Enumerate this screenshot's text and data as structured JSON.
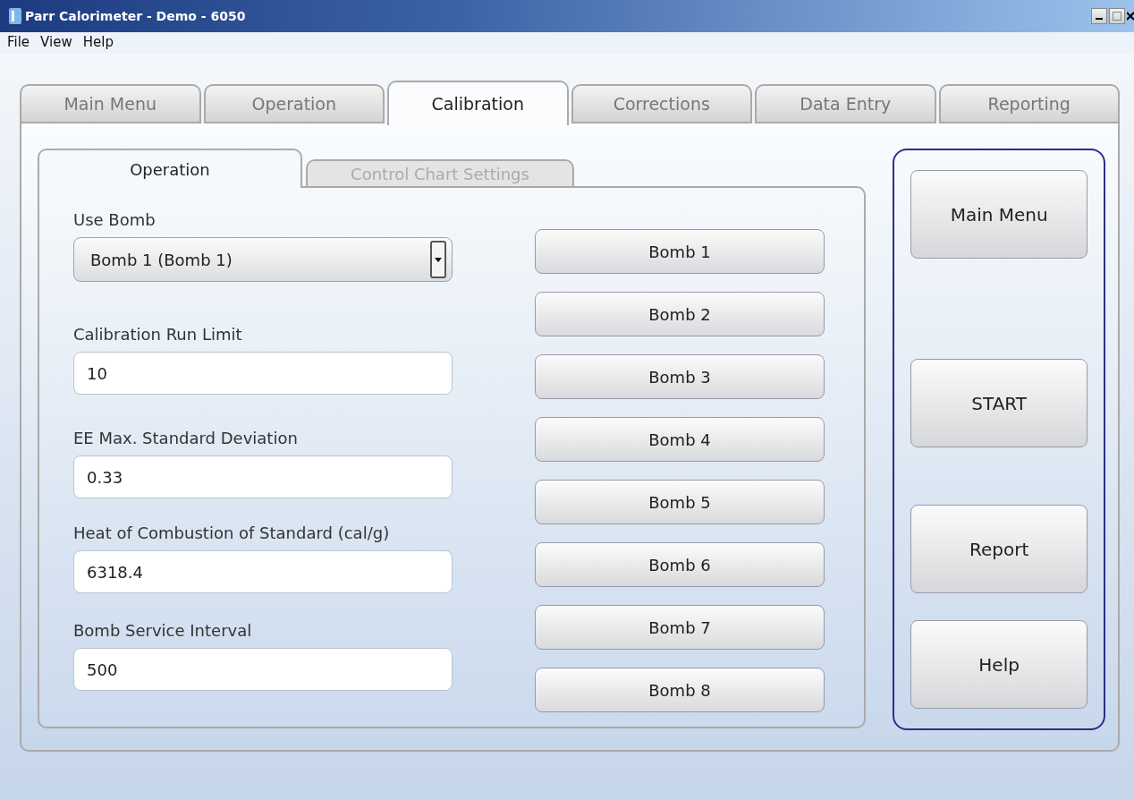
{
  "window": {
    "title": "Parr Calorimeter - Demo - 6050"
  },
  "menu": [
    "File",
    "View",
    "Help"
  ],
  "tabs": [
    {
      "label": "Main Menu",
      "selected": false
    },
    {
      "label": "Operation",
      "selected": false
    },
    {
      "label": "Calibration",
      "selected": true
    },
    {
      "label": "Corrections",
      "selected": false
    },
    {
      "label": "Data Entry",
      "selected": false
    },
    {
      "label": "Reporting",
      "selected": false
    }
  ],
  "sub_tabs": [
    {
      "label": "Operation",
      "selected": true
    },
    {
      "label": "Control Chart Settings",
      "selected": false
    }
  ],
  "fields": [
    {
      "kind": "dropdown",
      "label": "Use Bomb",
      "value": "Bomb 1 (Bomb 1)"
    },
    {
      "kind": "text",
      "label": "Calibration Run Limit",
      "value": "10"
    },
    {
      "kind": "text",
      "label": "EE Max. Standard Deviation",
      "value": "0.33"
    },
    {
      "kind": "text",
      "label": "Heat of Combustion of Standard (cal/g)",
      "value": "6318.4"
    },
    {
      "kind": "text",
      "label": "Bomb Service Interval",
      "value": "500"
    }
  ],
  "bomb_buttons": [
    "Bomb 1",
    "Bomb 2",
    "Bomb 3",
    "Bomb 4",
    "Bomb 5",
    "Bomb 6",
    "Bomb 7",
    "Bomb 8"
  ],
  "side_buttons": [
    "Main Menu",
    "START",
    "Report",
    "Help"
  ]
}
